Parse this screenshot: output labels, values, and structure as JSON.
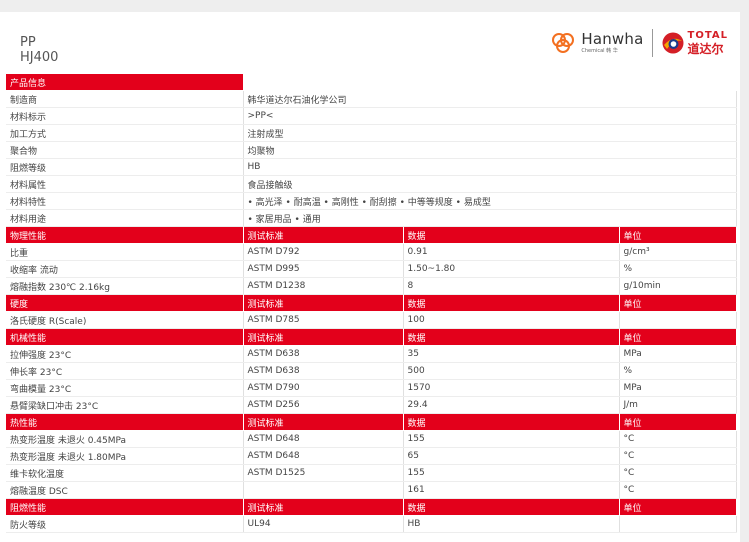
{
  "product": {
    "type": "PP",
    "grade": "HJ400"
  },
  "logos": {
    "hanwha_name": "Hanwha",
    "hanwha_sub": "Chemical  韩  华",
    "total_name": "TOTAL",
    "total_cn": "道达尔"
  },
  "colors": {
    "accent": "#e3001b",
    "hanwha_orange": "#f37021",
    "total_blue": "#1a3a8c"
  },
  "general": {
    "title": "产品信息",
    "rows": [
      {
        "label": "制造商",
        "value": "韩华道达尔石油化学公司"
      },
      {
        "label": "材料标示",
        "value": ">PP<"
      },
      {
        "label": "加工方式",
        "value": "注射成型"
      },
      {
        "label": "聚合物",
        "value": "均聚物"
      },
      {
        "label": "阻燃等级",
        "value": "HB"
      },
      {
        "label": "材料属性",
        "value": "食品接触级"
      },
      {
        "label": "材料特性",
        "value": "• 高光泽  • 耐高温  • 高刚性  • 耐刮擦  • 中等等规度  • 易成型"
      },
      {
        "label": "材料用途",
        "value": "• 家居用品  • 通用"
      }
    ]
  },
  "headers": {
    "method": "测试标准",
    "value": "数据",
    "unit": "单位"
  },
  "sections": [
    {
      "title": "物理性能",
      "rows": [
        {
          "property": "比重",
          "method": "ASTM D792",
          "value": "0.91",
          "unit": "g/cm³"
        },
        {
          "property": "收缩率  流动",
          "method": "ASTM D995",
          "value": "1.50~1.80",
          "unit": "%"
        },
        {
          "property": "熔融指数  230℃ 2.16kg",
          "method": "ASTM D1238",
          "value": "8",
          "unit": "g/10min"
        }
      ]
    },
    {
      "title": "硬度",
      "rows": [
        {
          "property": "洛氏硬度  R(Scale)",
          "method": "ASTM D785",
          "value": "100",
          "unit": ""
        }
      ]
    },
    {
      "title": "机械性能",
      "rows": [
        {
          "property": "拉伸强度  23°C",
          "method": "ASTM D638",
          "value": "35",
          "unit": "MPa"
        },
        {
          "property": "伸长率  23°C",
          "method": "ASTM D638",
          "value": "500",
          "unit": "%"
        },
        {
          "property": "弯曲模量  23°C",
          "method": "ASTM D790",
          "value": "1570",
          "unit": "MPa"
        },
        {
          "property": "悬臂梁缺口冲击  23°C",
          "method": "ASTM D256",
          "value": "29.4",
          "unit": "J/m"
        }
      ]
    },
    {
      "title": "热性能",
      "rows": [
        {
          "property": "热变形温度  未退火 0.45MPa",
          "method": "ASTM D648",
          "value": "155",
          "unit": "°C"
        },
        {
          "property": "热变形温度  未退火 1.80MPa",
          "method": "ASTM D648",
          "value": "65",
          "unit": "°C"
        },
        {
          "property": "维卡软化温度",
          "method": "ASTM D1525",
          "value": "155",
          "unit": "°C"
        },
        {
          "property": "熔融温度  DSC",
          "method": "",
          "value": "161",
          "unit": "°C"
        }
      ]
    },
    {
      "title": "阻燃性能",
      "rows": [
        {
          "property": "防火等级",
          "method": "UL94",
          "value": "HB",
          "unit": ""
        }
      ]
    }
  ]
}
